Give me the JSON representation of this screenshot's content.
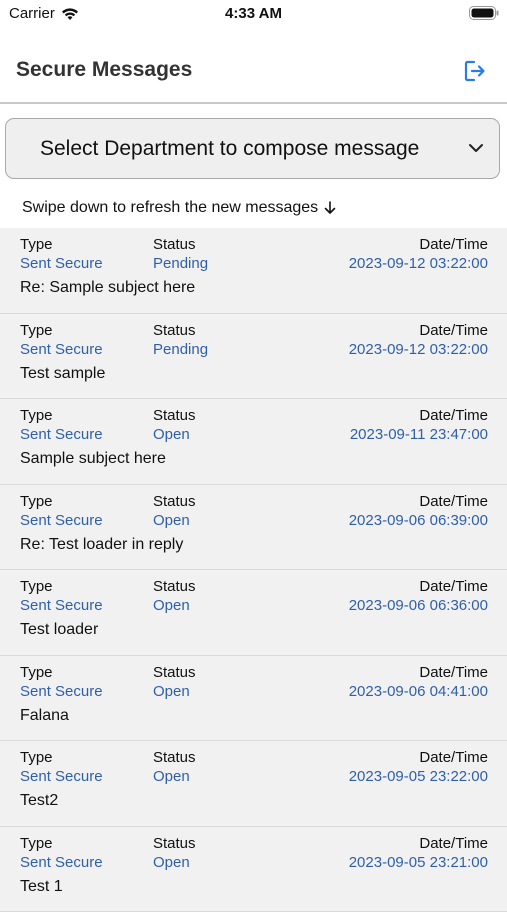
{
  "status_bar": {
    "carrier": "Carrier",
    "time": "4:33 AM"
  },
  "header": {
    "title": "Secure Messages",
    "logout_icon": "logout-icon"
  },
  "compose": {
    "dept_select_label": "Select Department to compose message"
  },
  "refresh_hint": "Swipe down to refresh the new messages",
  "columns": {
    "type": "Type",
    "status": "Status",
    "datetime": "Date/Time"
  },
  "colors": {
    "accent": "#2f5fa8",
    "row_bg": "#f1f1f2"
  },
  "messages": [
    {
      "type": "Sent Secure",
      "status": "Pending",
      "datetime": "2023-09-12 03:22:00",
      "subject": "Re: Sample subject here"
    },
    {
      "type": "Sent Secure",
      "status": "Pending",
      "datetime": "2023-09-12 03:22:00",
      "subject": "Test sample"
    },
    {
      "type": "Sent Secure",
      "status": "Open",
      "datetime": "2023-09-11 23:47:00",
      "subject": "Sample subject here"
    },
    {
      "type": "Sent Secure",
      "status": "Open",
      "datetime": "2023-09-06 06:39:00",
      "subject": "Re: Test loader in reply"
    },
    {
      "type": "Sent Secure",
      "status": "Open",
      "datetime": "2023-09-06 06:36:00",
      "subject": "Test loader"
    },
    {
      "type": "Sent Secure",
      "status": "Open",
      "datetime": "2023-09-06 04:41:00",
      "subject": "Falana"
    },
    {
      "type": "Sent Secure",
      "status": "Open",
      "datetime": "2023-09-05 23:22:00",
      "subject": "Test2"
    },
    {
      "type": "Sent Secure",
      "status": "Open",
      "datetime": "2023-09-05 23:21:00",
      "subject": "Test 1"
    }
  ]
}
